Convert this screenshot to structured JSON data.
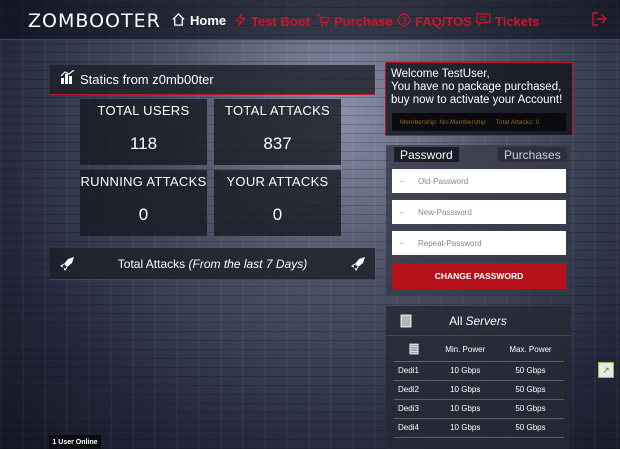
{
  "nav": {
    "logo": "ZOMBOOTER",
    "items": [
      {
        "label": "Home",
        "icon": "home-icon",
        "active": true
      },
      {
        "label": "Test Boot",
        "icon": "bolt-icon",
        "active": false
      },
      {
        "label": "Purchase",
        "icon": "cart-icon",
        "active": false
      },
      {
        "label": "FAQ/TOS",
        "icon": "question-icon",
        "active": false
      },
      {
        "label": "Tickets",
        "icon": "ticket-icon",
        "active": false
      }
    ],
    "logout_icon": "logout-icon",
    "accent_color": "#d0142e"
  },
  "stats": {
    "title": "Statics from z0mb00ter",
    "boxes": [
      {
        "label": "TOTAL USERS",
        "value": "118"
      },
      {
        "label": "TOTAL ATTACKS",
        "value": "837"
      },
      {
        "label": "RUNNING ATTACKS",
        "value": "0"
      },
      {
        "label": "YOUR ATTACKS",
        "value": "0"
      }
    ]
  },
  "attacks_panel": {
    "title": "Total Attacks",
    "subtitle": "(From the last 7 Days)"
  },
  "online": "1 User Online",
  "welcome": {
    "line1": "Welcome TestUser,",
    "line2": "You have no package purchased,",
    "line3": "buy now to activate your Account!",
    "membership": "Membership: No-Membership",
    "total_attacks": "Total Attacks: 0"
  },
  "password": {
    "tab_active": "Password",
    "tab_inactive": "Purchases",
    "old_placeholder": "Old-Password",
    "new_placeholder": "New-Password",
    "repeat_placeholder": "Repeat-Password",
    "button": "CHANGE PASSWORD"
  },
  "servers": {
    "title": "All",
    "title_em": "Servers",
    "columns": [
      "",
      "Min. Power",
      "Max. Power"
    ],
    "rows": [
      {
        "name": "Dedi1",
        "min": "10 Gbps",
        "max": "50 Gbps"
      },
      {
        "name": "Dedi2",
        "min": "10 Gbps",
        "max": "50 Gbps"
      },
      {
        "name": "Dedi3",
        "min": "10 Gbps",
        "max": "50 Gbps"
      },
      {
        "name": "Dedi4",
        "min": "10 Gbps",
        "max": "50 Gbps"
      }
    ]
  }
}
